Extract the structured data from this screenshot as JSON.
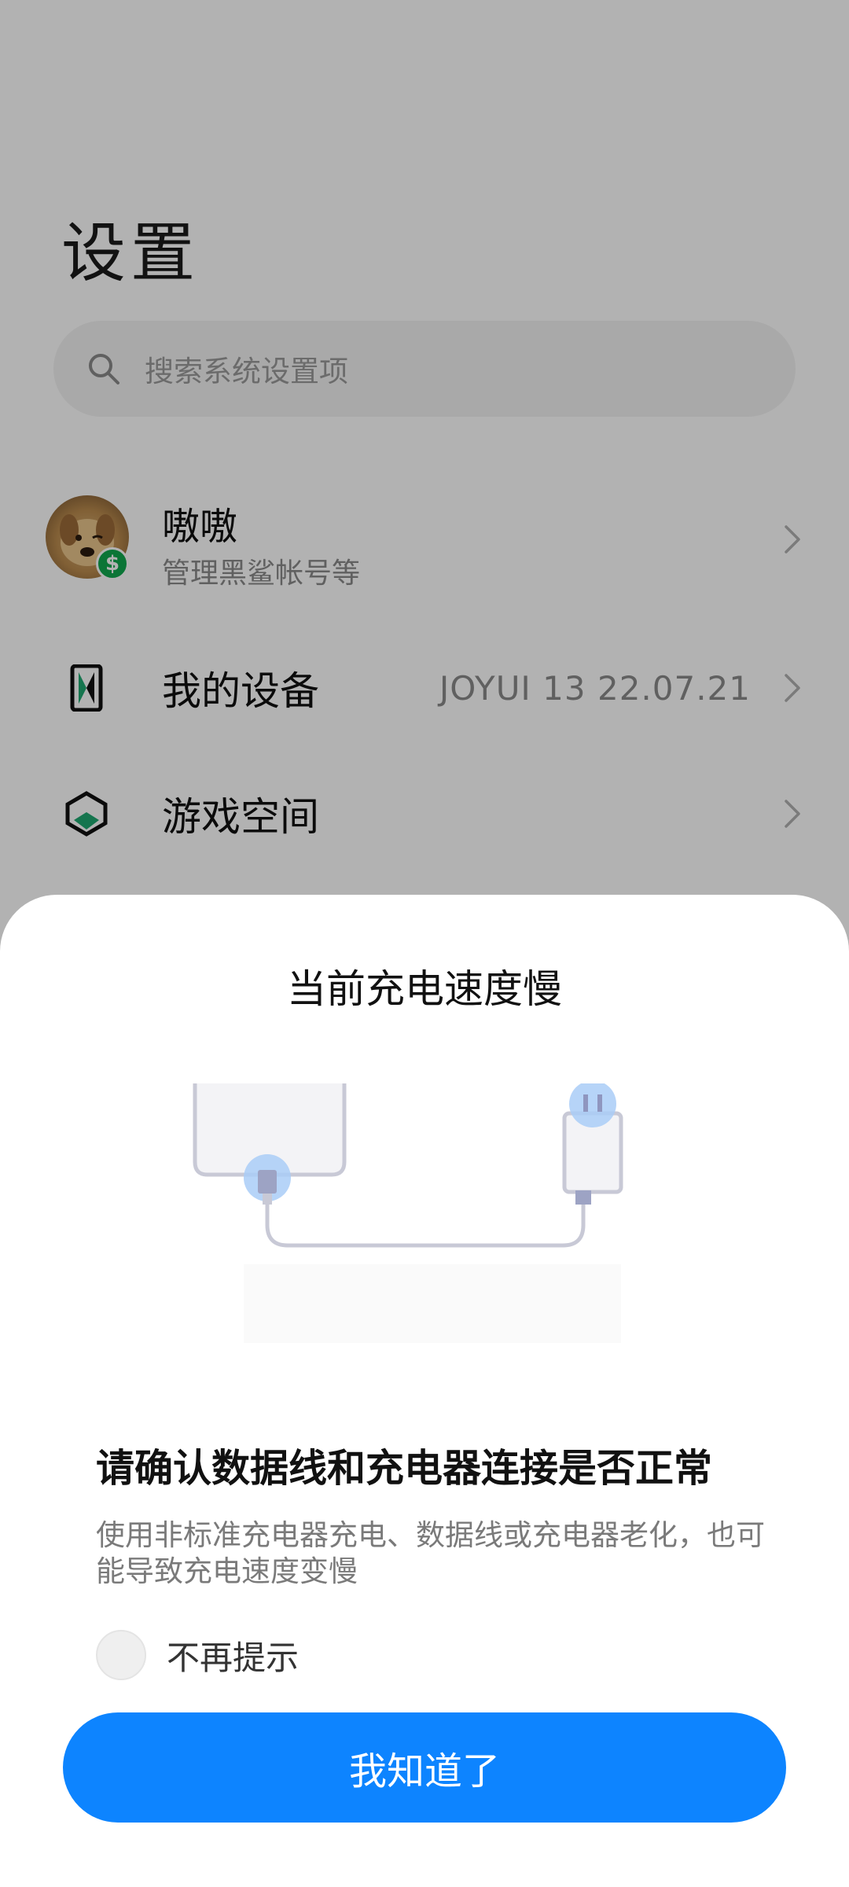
{
  "settings": {
    "title": "设置",
    "search": {
      "placeholder": "搜索系统设置项",
      "icon": "search-icon"
    },
    "account": {
      "name": "嗷嗷",
      "subtitle": "管理黑鲨帐号等",
      "badge_icon": "dollar-badge-icon"
    },
    "items": [
      {
        "label": "我的设备",
        "value": "JOYUI 13 22.07.21",
        "icon": "device-icon"
      },
      {
        "label": "游戏空间",
        "value": "",
        "icon": "game-space-icon"
      }
    ]
  },
  "dialog": {
    "title": "当前充电速度慢",
    "illustration": "phone-charger-cable-illustration",
    "heading": "请确认数据线和充电器连接是否正常",
    "body": "使用非标准充电器充电、数据线或充电器老化，也可能导致充电速度变慢",
    "checkbox_label": "不再提示",
    "checkbox_checked": false,
    "confirm_label": "我知道了"
  },
  "colors": {
    "accent": "#0d84ff",
    "badge_green": "#11a84e",
    "overlay": "rgba(0,0,0,0.30)"
  }
}
